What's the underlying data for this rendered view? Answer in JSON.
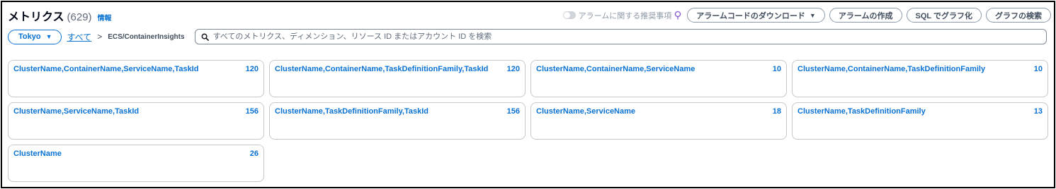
{
  "header": {
    "title": "メトリクス",
    "count": "(629)",
    "info_link": "情報"
  },
  "actions": {
    "toggle_label": "アラームに関する推奨事項",
    "toggle_on": false,
    "download_button": "アラームコードのダウンロード",
    "create_alarm_button": "アラームの作成",
    "sql_graph_button": "SQL でグラフ化",
    "browse_graphs_button": "グラフの検索"
  },
  "filter": {
    "region": "Tokyo",
    "breadcrumb_all": "すべて",
    "breadcrumb_current": "ECS/ContainerInsights",
    "search_placeholder": "すべてのメトリクス、ディメンション、リソース ID またはアカウント ID を検索",
    "search_value": ""
  },
  "dimension_cards": [
    {
      "label": "ClusterName,ContainerName,ServiceName,TaskId",
      "count": "120"
    },
    {
      "label": "ClusterName,ContainerName,TaskDefinitionFamily,TaskId",
      "count": "120"
    },
    {
      "label": "ClusterName,ContainerName,ServiceName",
      "count": "10"
    },
    {
      "label": "ClusterName,ContainerName,TaskDefinitionFamily",
      "count": "10"
    },
    {
      "label": "ClusterName,ServiceName,TaskId",
      "count": "156"
    },
    {
      "label": "ClusterName,TaskDefinitionFamily,TaskId",
      "count": "156"
    },
    {
      "label": "ClusterName,ServiceName",
      "count": "18"
    },
    {
      "label": "ClusterName,TaskDefinitionFamily",
      "count": "13"
    },
    {
      "label": "ClusterName",
      "count": "26"
    }
  ],
  "colors": {
    "link_blue": "#0972d3",
    "border_gray": "#c6c6cd",
    "text_dark": "#16191f"
  },
  "icons": {
    "toggle": "toggle-switch-icon",
    "hint": "lightbulb-icon",
    "dropdown": "caret-down-icon",
    "breadcrumb_separator": "chevron-right-icon",
    "search": "search-icon"
  }
}
